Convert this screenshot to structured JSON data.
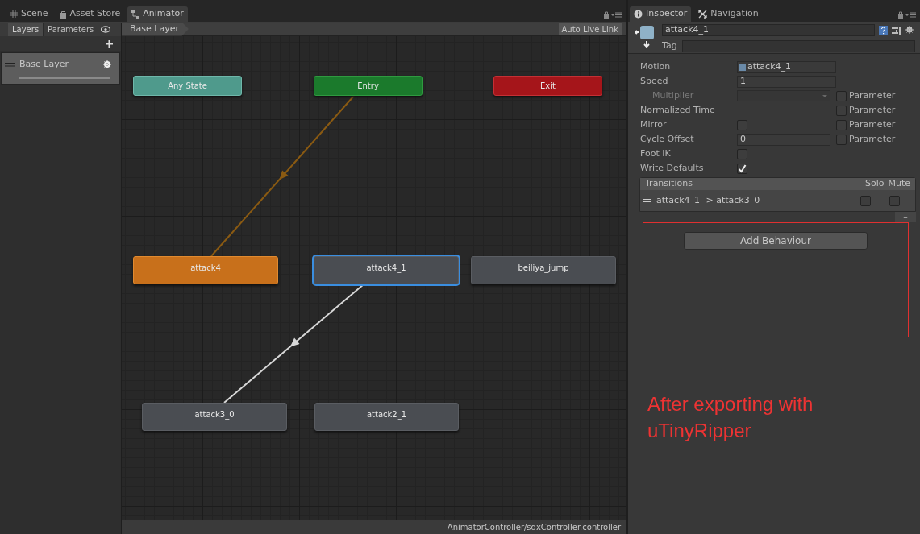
{
  "editor_tabs": [
    {
      "label": "Scene",
      "kind": "grid",
      "selected": false
    },
    {
      "label": "Asset Store",
      "kind": "bag",
      "selected": false
    },
    {
      "label": "Animator",
      "kind": "animator",
      "selected": true
    }
  ],
  "animator": {
    "side_tabs": [
      {
        "label": "Layers",
        "selected": true
      },
      {
        "label": "Parameters",
        "selected": false
      }
    ],
    "breadcrumb": "Base Layer",
    "live_link": "Auto Live Link",
    "layers": [
      {
        "name": "Base Layer",
        "selected": true
      }
    ],
    "states": [
      {
        "label": "Any State",
        "kind": "any_state",
        "selected": false
      },
      {
        "label": "Entry",
        "kind": "entry",
        "selected": false
      },
      {
        "label": "Exit",
        "kind": "exit",
        "selected": false
      },
      {
        "label": "attack4",
        "kind": "default_state",
        "selected": false
      },
      {
        "label": "attack4_1",
        "kind": "state",
        "selected": true
      },
      {
        "label": "beiliya_jump",
        "kind": "state",
        "selected": false
      },
      {
        "label": "attack3_0",
        "kind": "state",
        "selected": false
      },
      {
        "label": "attack2_1",
        "kind": "state",
        "selected": false
      }
    ],
    "transitions": [
      {
        "kind": "entry"
      },
      {
        "kind": "normal"
      }
    ],
    "status": "AnimatorController/sdxController.controller"
  },
  "inspector": {
    "tabs": [
      {
        "label": "Inspector",
        "kind": "info",
        "selected": true
      },
      {
        "label": "Navigation",
        "kind": "nav",
        "selected": false
      }
    ],
    "name": "attack4_1",
    "tag_label": "Tag",
    "fields": [
      {
        "label": "Motion",
        "kind": "object",
        "value": "attack4_1"
      },
      {
        "label": "Speed",
        "kind": "text",
        "value": "1"
      },
      {
        "label": "Multiplier",
        "kind": "dropdown",
        "disabled": true,
        "parameter": "Parameter",
        "parameter_checked": false
      },
      {
        "label": "Normalized Time",
        "kind": "none",
        "parameter": "Parameter",
        "parameter_checked": false
      },
      {
        "label": "Mirror",
        "kind": "checkbox",
        "checked": false,
        "parameter": "Parameter",
        "parameter_checked": false
      },
      {
        "label": "Cycle Offset",
        "kind": "short_text",
        "value": "0",
        "parameter": "Parameter",
        "parameter_checked": false
      },
      {
        "label": "Foot IK",
        "kind": "checkbox",
        "checked": false
      },
      {
        "label": "Write Defaults",
        "kind": "checkbox",
        "checked": true
      }
    ],
    "transitions": {
      "title": "Transitions",
      "solo": "Solo",
      "mute": "Mute",
      "items": [
        {
          "label": "attack4_1 -> attack3_0",
          "solo": false,
          "mute": false
        }
      ],
      "remove": "–"
    },
    "add_behaviour": "Add Behaviour"
  },
  "annotation": "After exporting with uTinyRipper"
}
